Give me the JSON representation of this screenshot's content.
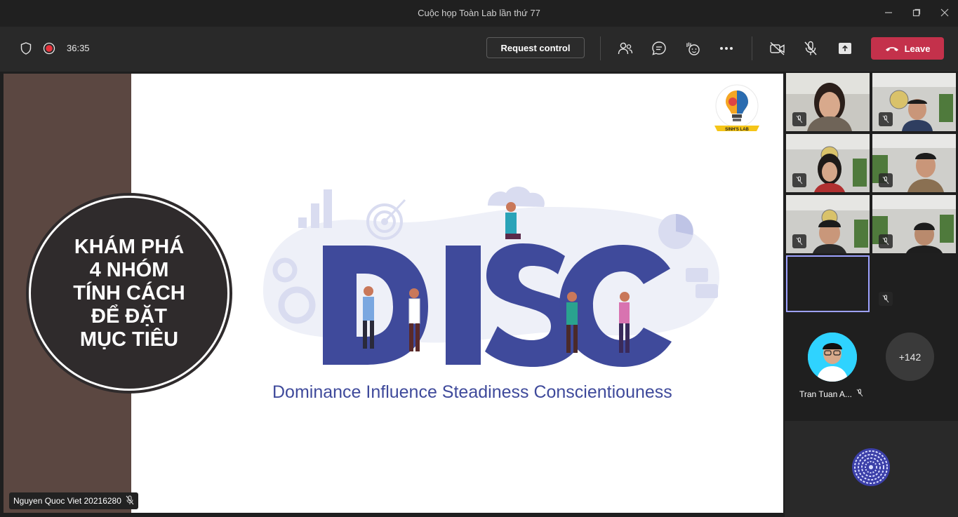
{
  "window": {
    "title": "Cuộc họp Toàn Lab lần thứ 77"
  },
  "toolbar": {
    "timer": "36:35",
    "request_control_label": "Request control",
    "leave_label": "Leave"
  },
  "slide": {
    "heading_lines": [
      "KHÁM PHÁ",
      "4 NHÓM",
      "TÍNH CÁCH",
      "ĐỂ ĐẶT",
      "MỤC TIÊU"
    ],
    "disc_title": "DISC",
    "tagline": "Dominance Influence Steadiness Conscientiouness",
    "logo_caption": "SINH'S LAB"
  },
  "presenter": {
    "name": "Nguyen Quoc Viet 20216280"
  },
  "participants": {
    "featured_name": "Tran Tuan A...",
    "overflow_count": "+142"
  },
  "colors": {
    "leave": "#c4314b",
    "disc_blue": "#3f4a9b",
    "sidebar": "#5b4741",
    "tile_highlight": "#9ea2ff"
  }
}
